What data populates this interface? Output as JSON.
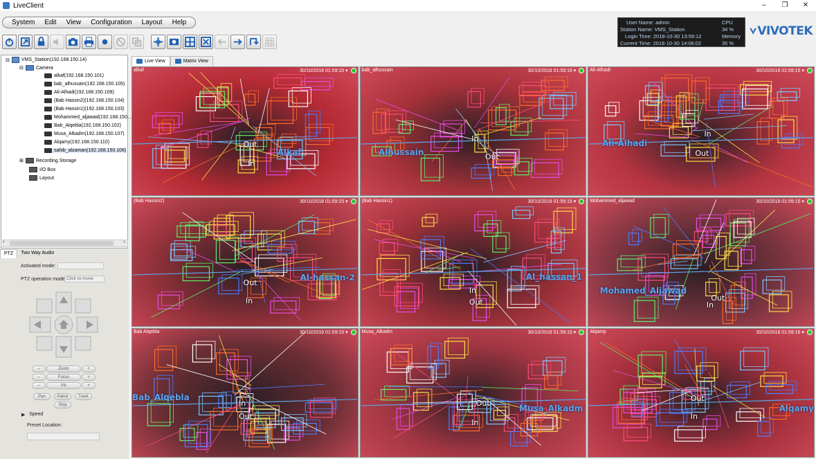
{
  "window": {
    "title": "LiveClient",
    "min": "–",
    "restore": "❐",
    "close": "✕"
  },
  "menu": [
    "System",
    "Edit",
    "View",
    "Configuration",
    "Layout",
    "Help"
  ],
  "status": {
    "user_name": "User Name: admin",
    "station_name": "Station Name: VMS_Station",
    "login_time": "Login Time: 2018-10-30 13:59:12",
    "current_time": "Current Time: 2018-10-30 14:06:02",
    "cpu_label": "CPU",
    "cpu_value": "34 %",
    "memory_label": "Memory",
    "memory_value": "35 %"
  },
  "brand": "VIVOTEK",
  "tree": {
    "station": "VMS_Station(192.168.150.14)",
    "camera_group": "Camera",
    "cameras": [
      "alkaf(192.168.150.101)",
      "bab_alhussain(192.168.150.105)",
      "Ali-Alhadi(192.168.150.109)",
      "(Bab Hassin2)(192.168.150.104)",
      "(Bab Hassin1)(192.168.150.103)",
      "Mohammed_aljawad(192.168.150...",
      "Bab_Alqebla(192.168.150.102)",
      "Musa_Alkadm(192.168.150.107)",
      "Alqamy(192.168.150.110)",
      "sahib_alzaman(192.168.150.106)"
    ],
    "recording_storage": "Recording Storage",
    "io_box": "I/O Box",
    "layout": "Layout"
  },
  "ptz": {
    "tab_ptz": "PTZ",
    "tab_audio": "Two Way Audio",
    "activated_mode_label": "Activated mode:",
    "operation_mode_label": "PTZ operation mode:",
    "operation_mode_value": "Click to move",
    "zoom": "Zoom",
    "focus": "Focus",
    "iris": "Iris",
    "pan": "Pan",
    "patrol": "Patrol",
    "track": "Track",
    "stop": "Stop",
    "speed_label": "Speed",
    "preset_label": "Preset Location:"
  },
  "view_tabs": {
    "live": "Live View",
    "matrix": "Matrix View"
  },
  "cameras": [
    {
      "name": "alkaf",
      "ts": "30/10/2018 01:59:15 ▾",
      "area": "Alkaf",
      "tone": "#b42a34"
    },
    {
      "name": "bab_alhussain",
      "ts": "30/10/2018 01:59:16 ▾",
      "area": "Alhussain",
      "tone": "#a8323a"
    },
    {
      "name": "Ali-Alhadi",
      "ts": "30/10/2018 01:59:15 ▾",
      "area": "Ali-Alhadi",
      "tone": "#b33440"
    },
    {
      "name": "(Bab Hassin2)",
      "ts": "30/10/2018 01:59:15 ▾",
      "area": "Al-hassan-2",
      "tone": "#8e3038"
    },
    {
      "name": "(Bab Hassin1)",
      "ts": "30/10/2018 01:59:15 ▾",
      "area": "Al_hassan_1",
      "tone": "#9b3038"
    },
    {
      "name": "Mohammed_aljawad",
      "ts": "30/10/2018 01:59:15 ▾",
      "area": "Mohamed_Aljawad",
      "tone": "#7d3540"
    },
    {
      "name": "Bab Alqebla",
      "ts": "30/10/2018 01:59:15 ▾",
      "area": "Bab_Alqebla",
      "tone": "#6a2e34"
    },
    {
      "name": "Musa_Alkadm",
      "ts": "30/10/2018 01:59:15 ▾",
      "area": "Musa_Alkadm",
      "tone": "#a23642"
    },
    {
      "name": "Alqamy",
      "ts": "30/10/2018 01:59:16 ▾",
      "area": "Alqamy",
      "tone": "#a5303c"
    }
  ],
  "io": {
    "in": "In",
    "out": "Out"
  }
}
